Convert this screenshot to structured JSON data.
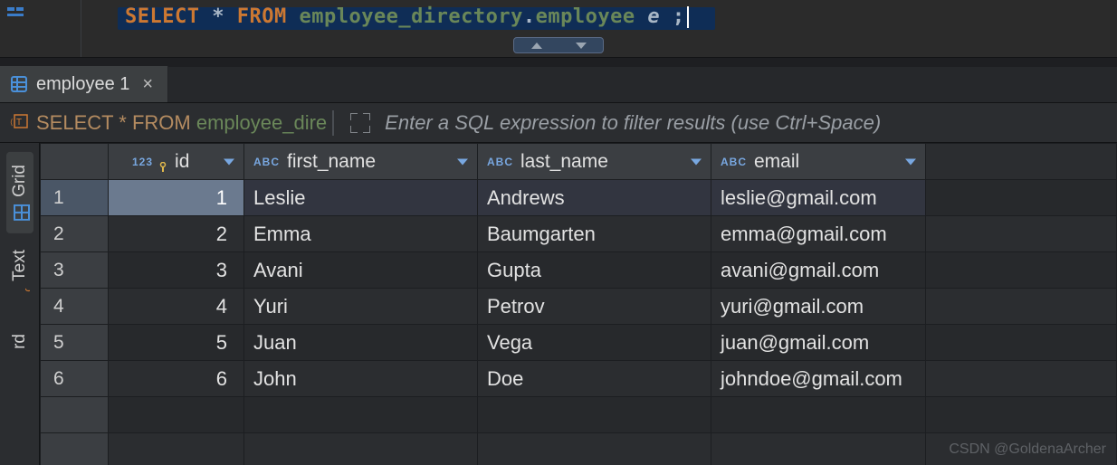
{
  "editor": {
    "tokens": {
      "select": "SELECT",
      "star": "*",
      "from": "FROM",
      "schema": "employee_directory",
      "dot": ".",
      "table": "employee",
      "alias": "e",
      "semi": ";"
    }
  },
  "tab": {
    "title": "employee 1",
    "close": "×"
  },
  "filterbar": {
    "sql_prefix": "SELECT * FROM ",
    "sql_table": "employee_dire",
    "hint": "Enter a SQL expression to filter results (use Ctrl+Space)"
  },
  "sidetabs": {
    "grid": "Grid",
    "text": "Text",
    "rd": "rd"
  },
  "columns": {
    "id": {
      "type": "123",
      "label": "id",
      "key": true
    },
    "first_name": {
      "type": "ABC",
      "label": "first_name"
    },
    "last_name": {
      "type": "ABC",
      "label": "last_name"
    },
    "email": {
      "type": "ABC",
      "label": "email"
    }
  },
  "rows": [
    {
      "n": "1",
      "id": "1",
      "first_name": "Leslie",
      "last_name": "Andrews",
      "email": "leslie@gmail.com"
    },
    {
      "n": "2",
      "id": "2",
      "first_name": "Emma",
      "last_name": "Baumgarten",
      "email": "emma@gmail.com"
    },
    {
      "n": "3",
      "id": "3",
      "first_name": "Avani",
      "last_name": "Gupta",
      "email": "avani@gmail.com"
    },
    {
      "n": "4",
      "id": "4",
      "first_name": "Yuri",
      "last_name": "Petrov",
      "email": "yuri@gmail.com"
    },
    {
      "n": "5",
      "id": "5",
      "first_name": "Juan",
      "last_name": "Vega",
      "email": "juan@gmail.com"
    },
    {
      "n": "6",
      "id": "6",
      "first_name": "John",
      "last_name": "Doe",
      "email": "johndoe@gmail.com"
    }
  ],
  "watermark": "CSDN @GoldenaArcher"
}
